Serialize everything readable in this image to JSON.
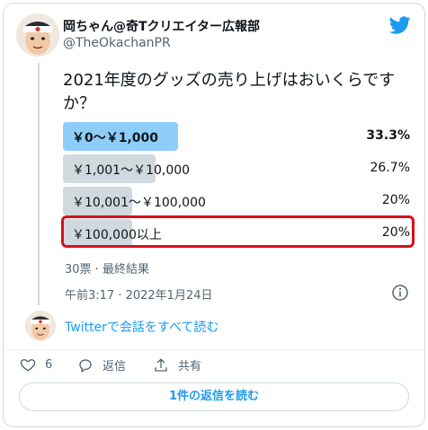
{
  "author": {
    "name": "岡ちゃん@奇Tクリエイター広報部",
    "handle": "@TheOkachanPR"
  },
  "tweet": {
    "text": "2021年度のグッズの売り上げはおいくらですか？"
  },
  "poll": {
    "options": [
      {
        "label": "￥0～￥1,000",
        "percent_text": "33.3%",
        "percent": 33.3,
        "winner": true
      },
      {
        "label": "￥1,001～￥10,000",
        "percent_text": "26.7%",
        "percent": 26.7,
        "winner": false
      },
      {
        "label": "￥10,001～￥100,000",
        "percent_text": "20%",
        "percent": 20,
        "winner": false
      },
      {
        "label": "￥100,000以上",
        "percent_text": "20%",
        "percent": 20,
        "winner": false
      }
    ],
    "meta": "30票 · 最終結果"
  },
  "timestamp": "午前3:17 · 2022年1月24日",
  "read_conversation": "Twitterで会話をすべて読む",
  "actions": {
    "likes": "6",
    "reply_label": "返信",
    "share_label": "共有"
  },
  "replies_button": "1件の返信を読む",
  "colors": {
    "accent": "#1d9bf0",
    "winner_bar": "#8ecdf8",
    "bar": "#cfd9de",
    "highlight": "#d8101a"
  }
}
